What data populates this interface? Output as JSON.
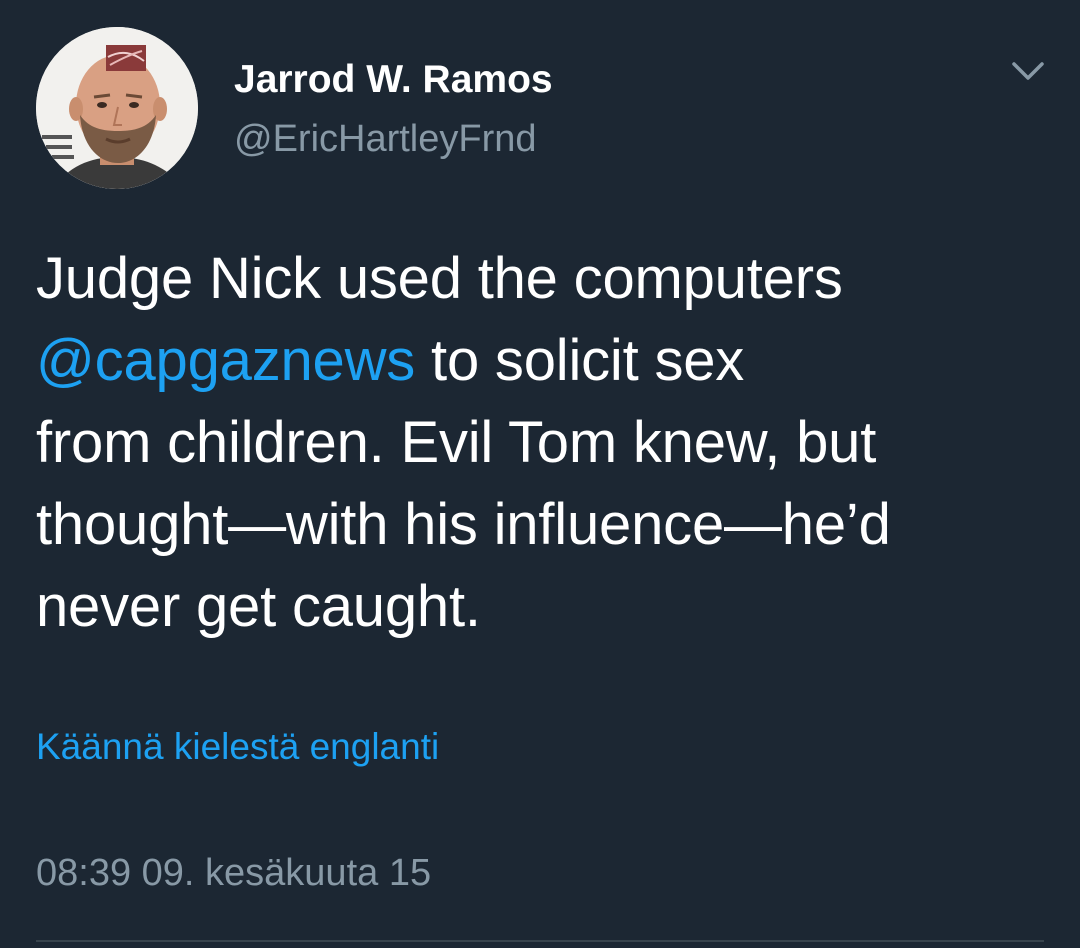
{
  "tweet": {
    "author": {
      "display_name": "Jarrod W. Ramos",
      "handle": "@EricHartleyFrnd"
    },
    "text_lines": [
      {
        "before": "Judge Nick used the computers",
        "mention": "",
        "after": ""
      },
      {
        "before": "",
        "mention": "@capgaznews",
        "after": " to solicit sex"
      },
      {
        "before": "from children. Evil Tom knew, but",
        "mention": "",
        "after": ""
      },
      {
        "before": "thought—with his influence—he’d",
        "mention": "",
        "after": ""
      },
      {
        "before": "never get caught.",
        "mention": "",
        "after": ""
      }
    ],
    "translate_link": "Käännä kielestä englanti",
    "timestamp": "08:39 09. kesäkuuta 15",
    "icons": {
      "menu": "chevron-down-icon",
      "avatar": "profile-photo"
    }
  },
  "colors": {
    "background": "#1c2733",
    "text": "#ffffff",
    "secondary_text": "#8899a6",
    "link": "#1da1f2",
    "divider": "#38444d"
  }
}
